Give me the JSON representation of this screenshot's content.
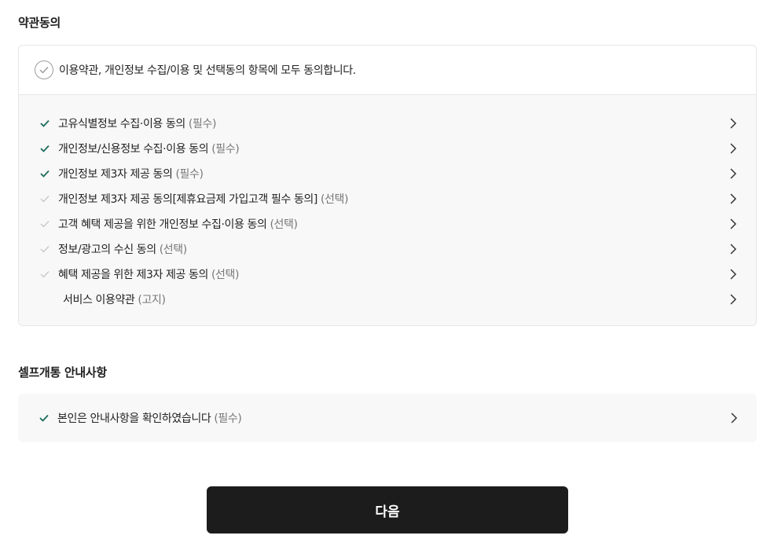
{
  "sections": {
    "terms_title": "약관동의",
    "self_open_title": "셀프개통 안내사항"
  },
  "agree_all": {
    "label": "이용약관, 개인정보 수집/이용 및 선택동의 항목에 모두 동의합니다."
  },
  "terms_items": [
    {
      "label": "고유식별정보 수집·이용 동의",
      "tag": "(필수)",
      "checked": true
    },
    {
      "label": "개인정보/신용정보 수집·이용 동의",
      "tag": "(필수)",
      "checked": true
    },
    {
      "label": "개인정보 제3자 제공 동의",
      "tag": "(필수)",
      "checked": true
    },
    {
      "label": "개인정보 제3자 제공 동의[제휴요금제 가입고객 필수 동의]",
      "tag": "(선택)",
      "checked": false
    },
    {
      "label": "고객 혜택 제공을 위한 개인정보 수집·이용 동의",
      "tag": "(선택)",
      "checked": false
    },
    {
      "label": "정보/광고의 수신 동의",
      "tag": "(선택)",
      "checked": false
    },
    {
      "label": "혜택 제공을 위한 제3자 제공 동의",
      "tag": "(선택)",
      "checked": false
    },
    {
      "label": "서비스 이용약관",
      "tag": "(고지)",
      "checked": null
    }
  ],
  "self_open_item": {
    "label": "본인은 안내사항을 확인하였습니다",
    "tag": "(필수)",
    "checked": true
  },
  "next_button": "다음",
  "colors": {
    "check_active": "#1a6b5a",
    "check_inactive": "#c8c8c8",
    "button_bg": "#1c1c1c"
  }
}
